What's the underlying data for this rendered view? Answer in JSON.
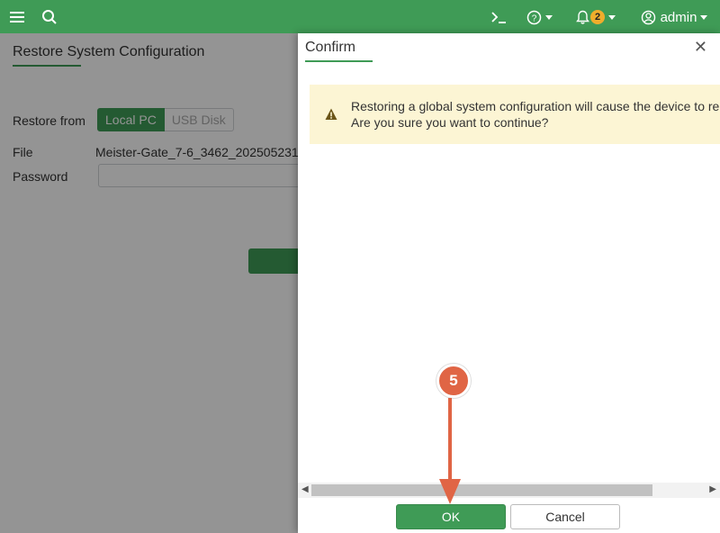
{
  "topbar": {
    "notifications_count": "2",
    "user_label": "admin"
  },
  "page": {
    "title": "Restore System Configuration",
    "restore_from_label": "Restore from",
    "restore_options": [
      "Local PC",
      "USB Disk"
    ],
    "file_label": "File",
    "file_value": "Meister-Gate_7-6_3462_202505231",
    "password_label": "Password"
  },
  "dialog": {
    "title": "Confirm",
    "warning_line1": "Restoring a global system configuration will cause the device to reb",
    "warning_line2": "Are you sure you want to continue?",
    "ok_label": "OK",
    "cancel_label": "Cancel"
  },
  "annotation": {
    "step_number": "5"
  },
  "colors": {
    "brand_green": "#3f9b56",
    "warning_bg": "#fcf5d4",
    "badge": "#f0ad2c",
    "annotation": "#e06545"
  },
  "icons": [
    "menu-icon",
    "search-icon",
    "cli-icon",
    "help-icon",
    "bell-icon",
    "user-icon",
    "close-icon",
    "warning-icon"
  ]
}
